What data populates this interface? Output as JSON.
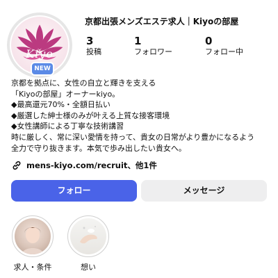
{
  "profile": {
    "username": "京都出張メンズエステ求人｜Kiyoの部屋",
    "avatar_logo_text": "Kiyo",
    "new_badge": "NEW"
  },
  "stats": [
    {
      "value": "3",
      "label": "投稿"
    },
    {
      "value": "1",
      "label": "フォロワー"
    },
    {
      "value": "0",
      "label": "フォロー中"
    }
  ],
  "bio": {
    "lines": [
      "京都を拠点に、女性の自立と輝きを支える",
      "「Kiyoの部屋」オーナーkiyo。",
      "◆最高還元70%・全額日払い",
      "◆厳選した紳士様のみが叶える上質な接客環境",
      "◆女性講師による丁寧な技術講習",
      "時に厳しく、常に深い愛情を持って、貴女の日常がより豊かになるよう",
      "全力で守り抜きます。本気で歩み出したい貴女へ。"
    ]
  },
  "link": {
    "text": "mens-kiyo.com/recruit、他1件",
    "icon": "link-icon"
  },
  "buttons": {
    "follow": "フォロー",
    "message": "メッセージ"
  },
  "highlights": [
    {
      "label": "求人・条件",
      "icon": "woman-portrait-image"
    },
    {
      "label": "想い",
      "icon": "hand-image"
    }
  ],
  "colors": {
    "follow_button": "#4a63e8",
    "message_button": "#eeeeef",
    "new_badge": "#5b8ae6",
    "logo_lotus": "#b8307a"
  }
}
